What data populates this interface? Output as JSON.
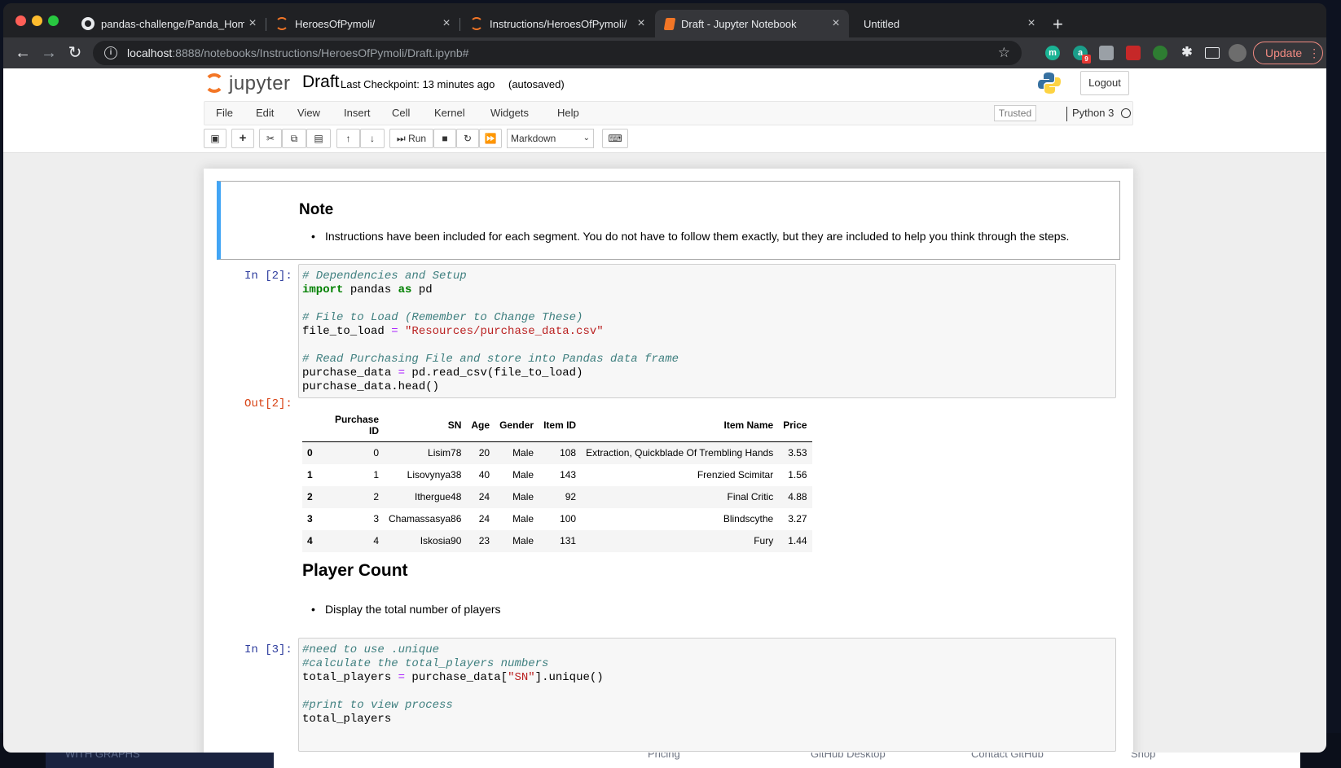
{
  "browser": {
    "tabs": [
      {
        "title": "pandas-challenge/Panda_Hom",
        "favicon": "github-icon",
        "active": false
      },
      {
        "title": "HeroesOfPymoli/",
        "favicon": "jupyter-icon",
        "active": false
      },
      {
        "title": "Instructions/HeroesOfPymoli/",
        "favicon": "jupyter-icon",
        "active": false
      },
      {
        "title": "Draft - Jupyter Notebook",
        "favicon": "notebook-icon",
        "active": true
      },
      {
        "title": "Untitled",
        "favicon": "",
        "active": false
      }
    ],
    "close_glyph": "×",
    "new_tab_glyph": "+",
    "url_host": "localhost",
    "url_rest": ":8888/notebooks/Instructions/HeroesOfPymoli/Draft.ipynb#",
    "update_label": "Update",
    "ext_m": "m",
    "ext_a": "a",
    "ext_badge": "9"
  },
  "jupyter": {
    "logo_text": "jupyter",
    "notebook_name": "Draft",
    "checkpoint": "Last Checkpoint: 13 minutes ago",
    "autosaved": "(autosaved)",
    "logout_label": "Logout",
    "menu": [
      "File",
      "Edit",
      "View",
      "Insert",
      "Cell",
      "Kernel",
      "Widgets",
      "Help"
    ],
    "trusted_label": "Trusted",
    "kernel_name": "Python 3",
    "toolbar": {
      "run_label": "Run",
      "cell_type": "Markdown"
    }
  },
  "cells": {
    "note_heading": "Note",
    "note_bullet": "Instructions have been included for each segment. You do not have to follow them exactly, but they are included to help you think through the steps.",
    "in2_prompt": "In [2]:",
    "out2_prompt": "Out[2]:",
    "code2": {
      "l1": "# Dependencies and Setup",
      "l2_kw1": "import",
      "l2_mid": " pandas ",
      "l2_kw2": "as",
      "l2_end": " pd",
      "l4": "# File to Load (Remember to Change These)",
      "l5_a": "file_to_load ",
      "l5_op": "=",
      "l5_str": " \"Resources/purchase_data.csv\"",
      "l7": "# Read Purchasing File and store into Pandas data frame",
      "l8_a": "purchase_data ",
      "l8_op": "=",
      "l8_b": " pd.read_csv(file_to_load)",
      "l9": "purchase_data.head()"
    },
    "table": {
      "columns": [
        "",
        "Purchase ID",
        "SN",
        "Age",
        "Gender",
        "Item ID",
        "Item Name",
        "Price"
      ],
      "rows": [
        [
          "0",
          "0",
          "Lisim78",
          "20",
          "Male",
          "108",
          "Extraction, Quickblade Of Trembling Hands",
          "3.53"
        ],
        [
          "1",
          "1",
          "Lisovynya38",
          "40",
          "Male",
          "143",
          "Frenzied Scimitar",
          "1.56"
        ],
        [
          "2",
          "2",
          "Ithergue48",
          "24",
          "Male",
          "92",
          "Final Critic",
          "4.88"
        ],
        [
          "3",
          "3",
          "Chamassasya86",
          "24",
          "Male",
          "100",
          "Blindscythe",
          "3.27"
        ],
        [
          "4",
          "4",
          "Iskosia90",
          "23",
          "Male",
          "131",
          "Fury",
          "1.44"
        ]
      ]
    },
    "player_count_heading": "Player Count",
    "player_count_bullet": "Display the total number of players",
    "in3_prompt": "In [3]:",
    "code3": {
      "l1": "#need to use .unique",
      "l2": "#calculate the total_players numbers",
      "l3_a": "total_players ",
      "l3_op": "=",
      "l3_b": " purchase_data[",
      "l3_str": "\"SN\"",
      "l3_c": "].unique()",
      "l5": "#print to view process",
      "l6": "total_players"
    }
  },
  "behind": {
    "left_text": "WITH GRAPHS",
    "items": [
      "Pricing",
      "GitHub Desktop",
      "Contact GitHub",
      "Shop"
    ]
  }
}
